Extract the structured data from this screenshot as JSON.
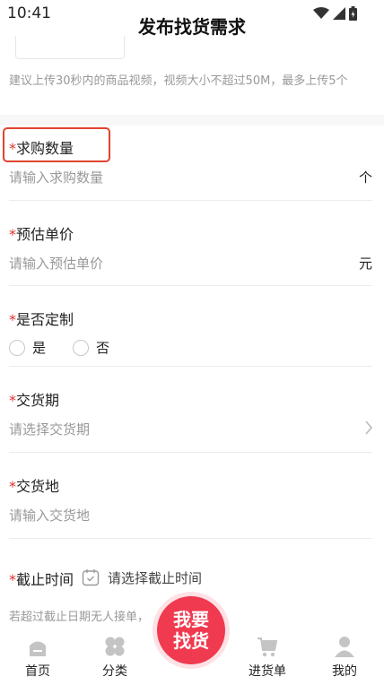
{
  "status_bar": {
    "time": "10:41"
  },
  "header": {
    "title": "发布找货需求"
  },
  "upload": {
    "hint": "建议上传30秒内的商品视频，视频大小不超过50M，最多上传5个"
  },
  "fields": {
    "quantity": {
      "required_mark": "*",
      "label": "求购数量",
      "placeholder": "请输入求购数量",
      "unit": "个"
    },
    "price": {
      "required_mark": "*",
      "label": "预估单价",
      "placeholder": "请输入预估单价",
      "unit": "元"
    },
    "custom": {
      "required_mark": "*",
      "label": "是否定制",
      "options": [
        "是",
        "否"
      ]
    },
    "delivery_period": {
      "required_mark": "*",
      "label": "交货期",
      "placeholder": "请选择交货期"
    },
    "delivery_place": {
      "required_mark": "*",
      "label": "交货地",
      "placeholder": "请输入交货地"
    },
    "deadline": {
      "required_mark": "*",
      "label": "截止时间",
      "placeholder": "请选择截止时间"
    }
  },
  "notice": "若超过截止日期无人接单，",
  "tabbar": {
    "items": [
      {
        "label": "首页",
        "icon": "home-icon"
      },
      {
        "label": "分类",
        "icon": "category-icon"
      },
      {
        "label": "进货单",
        "icon": "cart-icon"
      },
      {
        "label": "我的",
        "icon": "profile-icon"
      }
    ],
    "fab_line1": "我要",
    "fab_line2": "找货"
  },
  "colors": {
    "required": "#e0322a",
    "fab": "#f03a4f",
    "highlight": "#e0442e"
  }
}
